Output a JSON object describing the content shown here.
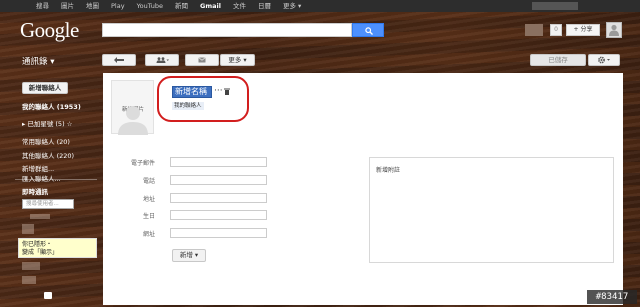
{
  "topbar": {
    "nav": [
      "搜尋",
      "圖片",
      "地圖",
      "Play",
      "YouTube",
      "新聞",
      "Gmail",
      "文件",
      "日曆",
      "更多 ▾"
    ],
    "active": "Gmail"
  },
  "logo": "Google",
  "header": {
    "notification_count": "0",
    "share_label": "+ 分享"
  },
  "sidebar": {
    "app_title": "通訊錄 ▾",
    "new_contact_label": "新增聯絡人",
    "my_contacts": "我的聯絡人 (1953)",
    "favorites": "▸ 已加星號 (5) ☆",
    "frequent": "常用聯絡人 (20)",
    "other": "其他聯絡人 (220)",
    "new_group": "新增群組...",
    "import": "匯入聯絡人...",
    "chat_title": "即時通訊",
    "chat_search_placeholder": "搜尋使用者...",
    "status_line1": "你已隱形・",
    "status_line2": "變成「顯示」"
  },
  "toolbar": {
    "more_label": "更多 ▾",
    "saved_label": "已儲存"
  },
  "contact": {
    "add_photo": "新增圖片",
    "name_value": "新增名稱",
    "more_dots": "···",
    "label_chip": "我的聯絡人",
    "fields": [
      "電子郵件",
      "電話",
      "地址",
      "生日",
      "網址"
    ],
    "add_field_button": "新增 ▾",
    "notes_placeholder": "新增附註"
  },
  "watermark": "#83417",
  "colors": {
    "highlight_circle": "#d21e1e",
    "search_button": "#4d90fe",
    "name_selection": "#3d6fbf"
  }
}
